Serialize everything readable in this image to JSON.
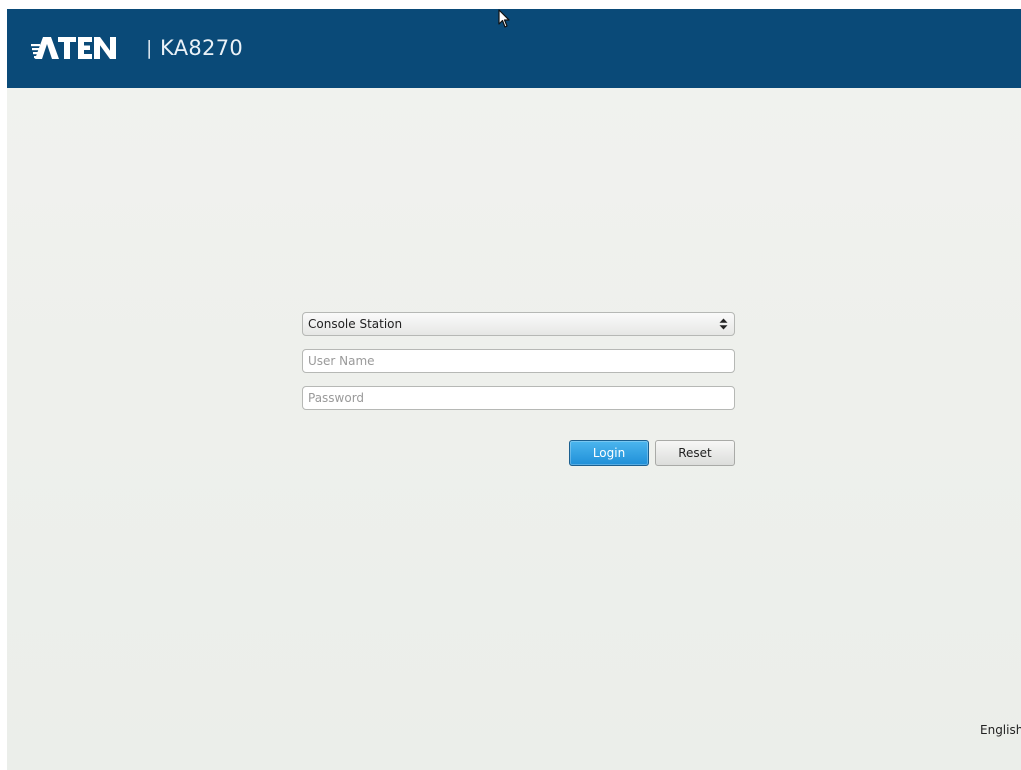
{
  "header": {
    "brand": "ATEN",
    "separator": "|",
    "model": "KA8270",
    "background_color": "#0a4a78"
  },
  "login": {
    "mode_select": {
      "value": "Console Station",
      "icon": "up-down-arrows-icon"
    },
    "username": {
      "value": "",
      "placeholder": "User Name"
    },
    "password": {
      "value": "",
      "placeholder": "Password"
    },
    "login_label": "Login",
    "reset_label": "Reset",
    "login_color": "#1f8fd8"
  },
  "footer": {
    "language": "English"
  },
  "pointer": {
    "icon": "mouse-pointer-icon"
  }
}
